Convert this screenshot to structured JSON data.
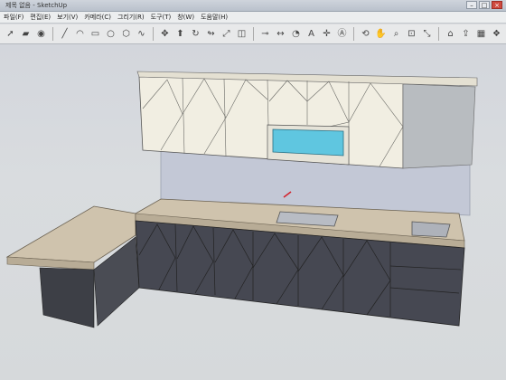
{
  "window": {
    "title": "제목 없음 - SketchUp"
  },
  "menu": [
    "파일(F)",
    "편집(E)",
    "보기(V)",
    "카메라(C)",
    "그리기(R)",
    "도구(T)",
    "창(W)",
    "도움말(H)"
  ],
  "toolbar": {
    "tools": [
      "select-icon",
      "eraser-icon",
      "paint-bucket-icon",
      "sep",
      "line-icon",
      "arc-icon",
      "rectangle-icon",
      "circle-icon",
      "polygon-icon",
      "freehand-icon",
      "sep",
      "move-icon",
      "push-pull-icon",
      "rotate-icon",
      "follow-me-icon",
      "scale-icon",
      "offset-icon",
      "sep",
      "tape-measure-icon",
      "dimension-icon",
      "protractor-icon",
      "text-icon",
      "axes-icon",
      "3d-text-icon",
      "sep",
      "orbit-icon",
      "pan-icon",
      "zoom-icon",
      "zoom-window-icon",
      "zoom-extents-icon",
      "sep",
      "warehouse-icon",
      "share-model-icon",
      "components-icon",
      "extension-icon"
    ]
  },
  "colors": {
    "cabinet_white": "#f1eee2",
    "cabinet_dark": "#4a4c54",
    "countertop": "#cfc3ad",
    "backsplash": "#c3c8d6",
    "range_hood_glass": "#5fc6e0",
    "sink": "#b8bcc4",
    "viewport_bg": "#d6d9dc"
  }
}
